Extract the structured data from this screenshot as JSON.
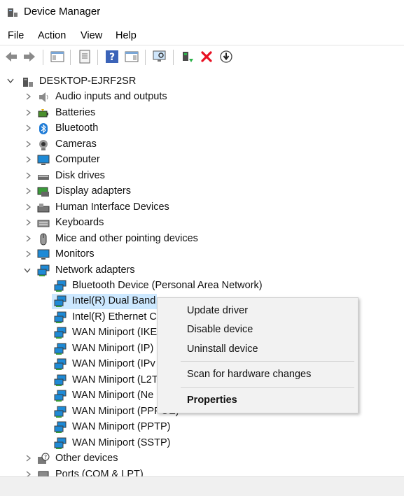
{
  "window": {
    "title": "Device Manager"
  },
  "menu": [
    "File",
    "Action",
    "View",
    "Help"
  ],
  "tree": {
    "root": "DESKTOP-EJRF2SR",
    "categories": [
      "Audio inputs and outputs",
      "Batteries",
      "Bluetooth",
      "Cameras",
      "Computer",
      "Disk drives",
      "Display adapters",
      "Human Interface Devices",
      "Keyboards",
      "Mice and other pointing devices",
      "Monitors",
      "Network adapters"
    ],
    "network_devices": [
      "Bluetooth Device (Personal Area Network)",
      "Intel(R) Dual Band",
      "Intel(R) Ethernet Co",
      "WAN Miniport (IKE",
      "WAN Miniport (IP)",
      "WAN Miniport (IPv",
      "WAN Miniport (L2T",
      "WAN Miniport (Ne",
      "WAN Miniport (PPPOE)",
      "WAN Miniport (PPTP)",
      "WAN Miniport (SSTP)"
    ],
    "after": [
      "Other devices",
      "Ports (COM & LPT)"
    ]
  },
  "context_menu": {
    "update": "Update driver",
    "disable": "Disable device",
    "uninstall": "Uninstall device",
    "scan": "Scan for hardware changes",
    "properties": "Properties"
  },
  "colors": {
    "selection": "#cce8ff",
    "remove_icon": "#e81123",
    "monitor_blue": "#1e8ad6"
  }
}
